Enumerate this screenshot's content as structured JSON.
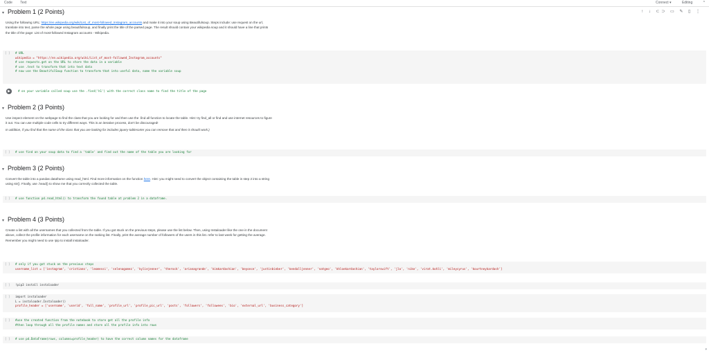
{
  "topbar": {
    "menu": [
      "Code",
      "Text"
    ],
    "connect": "Connect ▾",
    "editing": "Editing",
    "collapse": "^"
  },
  "cell_toolbar": "↑ ↓ ⊂⊃ ▭ ✎ ▯ ⋮",
  "problem1": {
    "title": "Problem 1 (2 Points)",
    "text_pre": "Using the following URL: ",
    "link": "https://en.wikipedia.org/wiki/List_of_most-followed_Instagram_accounts",
    "text_post": " and make it into your soup using Beautifulsoup. Steps include: use request on the url, translate into text, parse the whole page using beautifulsoup, and finally print the title of the parsed page. The result should contain your wikipedia soup and it should have a line that prints the title of the page: List of most-followed Instagram accounts - Wikipedia.",
    "code_lines": [
      "# URL",
      "wikipedia = \"https://en.wikipedia.org/wiki/List_of_most-followed_Instagram_accounts\"",
      "",
      "# use requests.get on the URL to store the data in a variable",
      "# use .text to transform that into text data",
      "# now use the BeautifulSoup function to transform that into useful data, name the variable soup"
    ],
    "run_comment": "# on your variable called soup use the .find('h1') with the correct class name to find the title of the page"
  },
  "problem2": {
    "title": "Problem 2 (3 Points)",
    "text": "Use inspect element on the webpage to find the class that you are looking for and then use the .find all function to locate the table. Hint: try find_all or find and use internet resources to figure it out. You can use multiple code cells to try different ways. This is an iterative process, don't be discouraged!",
    "note": "In addition, if you find that the name of the class that you are looking for includes jquery-tablesorter you can remove that and then it should work.)",
    "code": "# use find on your soup data to find a 'table' and find out the name of the table you are looking for"
  },
  "problem3": {
    "title": "Problem 3 (2 Points)",
    "text_pre": "Convert the table into a pandas dataframe using read_html. Find more information on the function ",
    "link": "here",
    "text_post": ". Hint: you might need to convert the object containing the table in step 2 into a string using str(). Finally, use .head() to show me that you correctly collected the table.",
    "code": "# use function pd.read_html() to transform the found table at problem 2 in a dataframe."
  },
  "problem4": {
    "title": "Problem 4 (3 Points)",
    "text": "Create a list with all the usernames that you collected from the table. If you got stuck on the previous steps, please use the list below. Then, using Instaloader like the one in the document above, collect the profile information for each username on the ranking list. Finally, print the average number of followers of the users in this list. refer to last week for getting the average. Remember you might need to use !pip to install instaloader.",
    "code1_line1": "# only if you got stuck on the previous steps",
    "code1_line2": "username_list = ['instagram', 'cristiano', 'leomessi', 'selenagomez', 'kyliejenner', 'therock', 'arianagrande', 'kimkardashian', 'beyonce', 'justinbieber', 'kendalljenner', 'natgeo', 'khloekardashian', 'taylorswift', 'jlo', 'nike', 'virat.kohli', 'mileycyrus', 'kourtneykardash']",
    "code2": "!pip3 install instaloader",
    "code3_line1": "import instaloader",
    "code3_line2": "L = instaloader.Instaloader()",
    "code3_line3": "profile_header = ['username', 'userid', 'full_name', 'profile_url', 'profile_pic_url', 'posts', 'followers', 'followees', 'bio', 'external_url', 'business_category']",
    "code4_line1": "#use the created function from the notebook to store get all the profile info",
    "code4_line2": "#then loop through all the profile names and store all the profile info into rows",
    "code5": "# use pd.DataFrame(rows, columns=profile_header) to have the correct column names for the dataframe"
  },
  "run_marker": "[ ]",
  "run_icon": "▶"
}
